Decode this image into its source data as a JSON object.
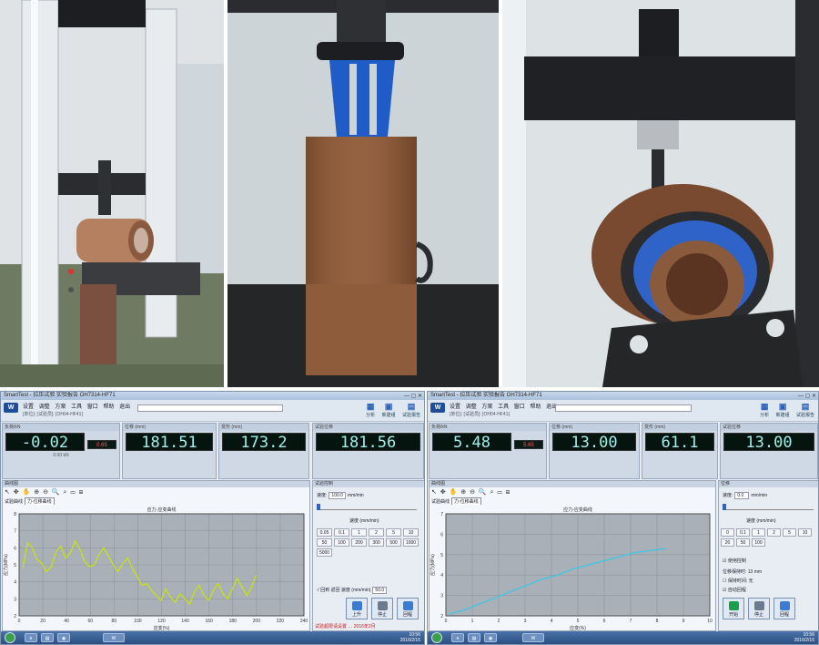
{
  "left_app": {
    "title": "SmartTest - 拉压试验 实验报告 OH7314-HF71",
    "menus": [
      "设置",
      "调整",
      "方案",
      "工具",
      "窗口",
      "帮助",
      "退出",
      "方案"
    ],
    "subtitle": "[单位]: [试验员]: [OH04-HF41]",
    "toolbar": [
      {
        "label": "分析",
        "icon": "analysis-icon"
      },
      {
        "label": "新建组",
        "icon": "new-group-icon"
      },
      {
        "label": "试验报告",
        "icon": "report-icon"
      }
    ],
    "lcds": [
      {
        "header": "负荷/kN",
        "value": "-0.02",
        "unit": "0.00 kN"
      },
      {
        "header": "峰值",
        "value": "0.65",
        "unit": ""
      },
      {
        "header": "位移 (mm)",
        "value": "181.51",
        "unit": ""
      },
      {
        "header": "变形 (mm)",
        "value": "173.2",
        "unit": ""
      },
      {
        "header": "试验位移",
        "value": "181.56",
        "unit": ""
      }
    ],
    "chart_header": "曲线图",
    "chart_toolbar": "↖ ✥ ✋ ⊕ ⊖ 🔍 ⌕ ▭ ⊞",
    "chart_selector_label": "试验曲线",
    "chart_selector_value": "力-位移曲线",
    "curve_title": "应力-应变曲线",
    "side_header": "试验控制",
    "speed_label": "速度:",
    "speed_value": "100.0",
    "speed_unit": "mm/min",
    "speed_group_label": "速度 (mm/min)",
    "speed_buttons": [
      "0.05",
      "0.1",
      "1",
      "2",
      "5",
      "10",
      "50",
      "100",
      "200",
      "300",
      "500",
      "1000",
      "5000"
    ],
    "return_label": "返回 速度 (mm/min)",
    "return_value": "50.0",
    "return_check": "√ 回到",
    "warning_text": "试验超限请设置 … 2016年2月",
    "actions": [
      {
        "label": "上升",
        "kind": "up"
      },
      {
        "label": "停止",
        "kind": "stop"
      },
      {
        "label": "回程",
        "kind": "return"
      }
    ],
    "clock_time": "10:56",
    "clock_date": "2016/2/16"
  },
  "right_app": {
    "title": "SmartTest - 拉压试验 实验报告 OH7314-HF71",
    "menus": [
      "设置",
      "调整",
      "方案",
      "工具",
      "窗口",
      "帮助",
      "退出",
      "方案"
    ],
    "subtitle": "[单位]: [试验员]: [OH04-HF41]",
    "toolbar": [
      {
        "label": "分析",
        "icon": "analysis-icon"
      },
      {
        "label": "新建组",
        "icon": "new-group-icon"
      },
      {
        "label": "试验报告",
        "icon": "report-icon"
      }
    ],
    "lcds": [
      {
        "header": "负荷/kN",
        "value": "5.48",
        "unit": ""
      },
      {
        "header": "峰值",
        "value": "5.65",
        "unit": ""
      },
      {
        "header": "位移 (mm)",
        "value": "13.00",
        "unit": ""
      },
      {
        "header": "变形 (mm)",
        "value": "61.1",
        "unit": ""
      },
      {
        "header": "试验位移",
        "value": "13.00",
        "unit": ""
      }
    ],
    "chart_header": "曲线图",
    "chart_toolbar": "↖ ✥ ✋ ⊕ ⊖ 🔍 ⌕ ▭ ⊞",
    "chart_selector_label": "试验曲线",
    "chart_selector_value": "力-位移曲线",
    "curve_title": "应力-应变曲线",
    "side_header": "位移",
    "speed_label": "速度:",
    "speed_value": "0.0",
    "speed_unit": "mm/min",
    "speed_group_label": "速度 (mm/min)",
    "speed_buttons": [
      "0",
      "0.1",
      "1",
      "2",
      "5",
      "10",
      "20",
      "50",
      "100"
    ],
    "options": [
      "☑ 使用控制",
      "位移保持时: 13 mm",
      "☐ 保持时间: 无",
      "☑ 自动回程"
    ],
    "actions": [
      {
        "label": "开始",
        "kind": "play"
      },
      {
        "label": "停止",
        "kind": "stop"
      },
      {
        "label": "回程",
        "kind": "return"
      }
    ],
    "clock_time": "10:56",
    "clock_date": "2016/2/16"
  },
  "chart_data": [
    {
      "type": "line",
      "series": [
        {
          "values": [
            4.8,
            6.3,
            6.0,
            5.3,
            5.1,
            4.6,
            4.9,
            5.8,
            6.1,
            5.4,
            5.7,
            6.4,
            5.9,
            5.2,
            4.9,
            5.0,
            5.6,
            6.0,
            5.5,
            5.0,
            4.6,
            5.1,
            5.4,
            4.8,
            4.3,
            3.8,
            3.9,
            3.5,
            3.2,
            2.9,
            3.6,
            3.1,
            2.8,
            3.3,
            3.0,
            2.7,
            3.4,
            3.8,
            3.2,
            2.9,
            3.5,
            3.9,
            3.3,
            3.0,
            3.6,
            4.2,
            3.7,
            3.2,
            3.7,
            4.4
          ]
        }
      ],
      "color": "#c9e600",
      "xlim": [
        0,
        250
      ],
      "ylim": [
        2,
        8
      ],
      "xticks": [
        "0",
        "20",
        "40",
        "60",
        "80",
        "100",
        "120",
        "140",
        "160",
        "180",
        "200",
        "220",
        "240"
      ],
      "yticks": [
        "2",
        "3",
        "4",
        "5",
        "6",
        "7",
        "8"
      ],
      "ylabel": "应力(MPa)",
      "xlabel": "应变(%)"
    },
    {
      "type": "line",
      "series": [
        {
          "values": [
            2.1,
            2.3,
            2.6,
            2.9,
            3.2,
            3.5,
            3.8,
            4.0,
            4.3,
            4.5,
            4.7,
            4.9,
            5.1,
            5.2,
            5.3
          ]
        }
      ],
      "color": "#38c8e8",
      "xlim": [
        0,
        10
      ],
      "ylim": [
        2,
        7
      ],
      "xticks": [
        "0",
        "1",
        "2",
        "3",
        "4",
        "5",
        "6",
        "7",
        "8",
        "9",
        "10"
      ],
      "yticks": [
        "2",
        "3",
        "4",
        "5",
        "6",
        "7"
      ],
      "ylabel": "应力(MPa)",
      "xlabel": "应变(%)"
    }
  ]
}
